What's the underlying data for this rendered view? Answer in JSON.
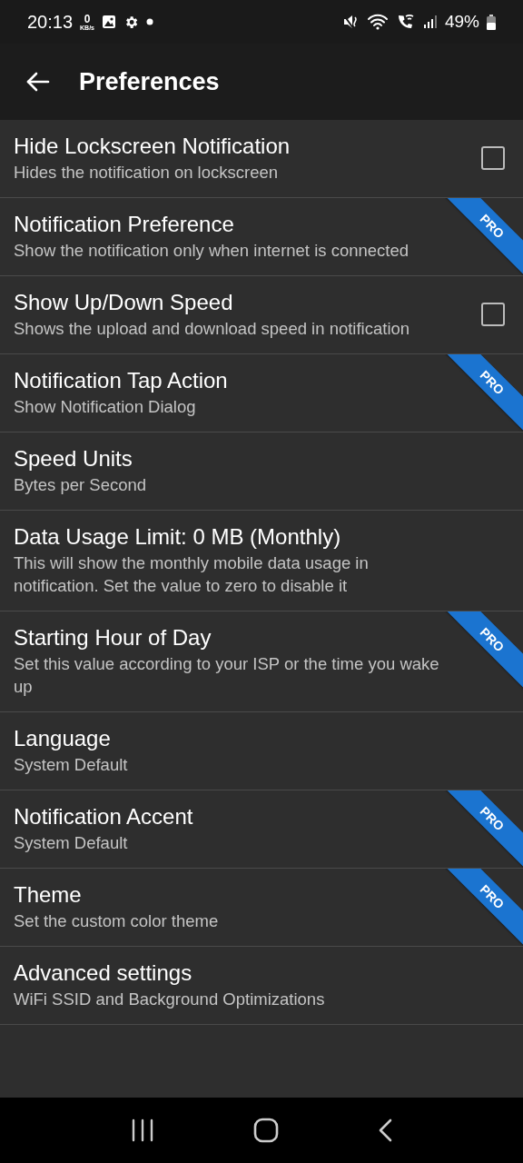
{
  "status_bar": {
    "time": "20:13",
    "net_speed": "0",
    "net_unit": "KB/s",
    "battery": "49%"
  },
  "toolbar": {
    "title": "Preferences"
  },
  "preferences": [
    {
      "title": "Hide Lockscreen Notification",
      "summary": "Hides the notification on lockscreen",
      "kind": "checkbox",
      "checked": false
    },
    {
      "title": "Notification Preference",
      "summary": "Show the notification only when internet is connected",
      "kind": "plain",
      "badge": "PRO"
    },
    {
      "title": "Show Up/Down Speed",
      "summary": "Shows the upload and download speed in notification",
      "kind": "checkbox",
      "checked": false
    },
    {
      "title": "Notification Tap Action",
      "summary": "Show Notification Dialog",
      "kind": "plain",
      "badge": "PRO"
    },
    {
      "title": "Speed Units",
      "summary": "Bytes per Second",
      "kind": "plain"
    },
    {
      "title": "Data Usage Limit: 0 MB (Monthly)",
      "summary": "This will show the monthly mobile data usage in notification. Set the value to zero to disable it",
      "kind": "plain"
    },
    {
      "title": "Starting Hour of Day",
      "summary": "Set this value according to your ISP or the time you wake up",
      "kind": "plain",
      "badge": "PRO"
    },
    {
      "title": "Language",
      "summary": "System Default",
      "kind": "plain"
    },
    {
      "title": "Notification Accent",
      "summary": "System Default",
      "kind": "plain",
      "badge": "PRO"
    },
    {
      "title": "Theme",
      "summary": "Set the custom color theme",
      "kind": "plain",
      "badge": "PRO"
    },
    {
      "title": "Advanced settings",
      "summary": "WiFi SSID and Background Optimizations",
      "kind": "plain"
    }
  ]
}
